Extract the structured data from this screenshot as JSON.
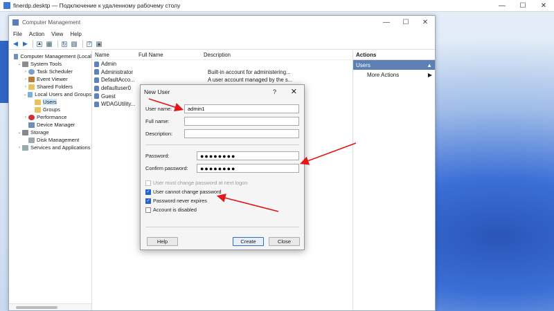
{
  "rdp": {
    "title": "finerdp.desktp — Подключение к удаленному рабочему столу",
    "controls": [
      "—",
      "☐",
      "✕"
    ]
  },
  "cm": {
    "title": "Computer Management",
    "controls": [
      "—",
      "☐",
      "✕"
    ],
    "menu": [
      "File",
      "Action",
      "View",
      "Help"
    ],
    "tree": [
      {
        "label": "Computer Management (Local",
        "icon": "computer-icon",
        "exp": "",
        "indent": 0
      },
      {
        "label": "System Tools",
        "icon": "tools-icon",
        "exp": "⌄",
        "indent": 1
      },
      {
        "label": "Task Scheduler",
        "icon": "clock-icon",
        "exp": "›",
        "indent": 2
      },
      {
        "label": "Event Viewer",
        "icon": "event-viewer-icon",
        "exp": "›",
        "indent": 2
      },
      {
        "label": "Shared Folders",
        "icon": "folder-icon",
        "exp": "›",
        "indent": 2
      },
      {
        "label": "Local Users and Groups",
        "icon": "users-icon",
        "exp": "⌄",
        "indent": 2
      },
      {
        "label": "Users",
        "icon": "folder-icon",
        "exp": "",
        "indent": 3,
        "selected": true
      },
      {
        "label": "Groups",
        "icon": "folder-icon",
        "exp": "",
        "indent": 3
      },
      {
        "label": "Performance",
        "icon": "performance-icon",
        "exp": "›",
        "indent": 2
      },
      {
        "label": "Device Manager",
        "icon": "device-manager-icon",
        "exp": "",
        "indent": 2
      },
      {
        "label": "Storage",
        "icon": "storage-icon",
        "exp": "⌄",
        "indent": 1
      },
      {
        "label": "Disk Management",
        "icon": "disk-icon",
        "exp": "",
        "indent": 2
      },
      {
        "label": "Services and Applications",
        "icon": "services-icon",
        "exp": "›",
        "indent": 1
      }
    ],
    "columns": [
      "Name",
      "Full Name",
      "Description"
    ],
    "users": [
      {
        "name": "Admin",
        "full": "",
        "desc": ""
      },
      {
        "name": "Administrator",
        "full": "",
        "desc": "Built-in account for administering..."
      },
      {
        "name": "DefaultAcco...",
        "full": "",
        "desc": "A user account managed by the s..."
      },
      {
        "name": "defaultuser0",
        "full": "",
        "desc": ""
      },
      {
        "name": "Guest",
        "full": "",
        "desc": ""
      },
      {
        "name": "WDAGUtility...",
        "full": "",
        "desc": ""
      }
    ],
    "actions": {
      "header": "Actions",
      "section": "Users",
      "more": "More Actions"
    }
  },
  "dialog": {
    "title": "New User",
    "help_glyph": "?",
    "close_glyph": "✕",
    "username_label": "User name:",
    "username_value": "admin1",
    "fullname_label": "Full name:",
    "fullname_value": "",
    "description_label": "Description:",
    "description_value": "",
    "password_label": "Password:",
    "password_value": "●●●●●●●●",
    "confirm_label": "Confirm password:",
    "confirm_value": "●●●●●●●●",
    "cb_must_change": {
      "label": "User must change password at next logon",
      "checked": false,
      "disabled": true
    },
    "cb_cannot_change": {
      "label": "User cannot change password",
      "checked": true,
      "disabled": false
    },
    "cb_never_expires": {
      "label": "Password never expires",
      "checked": true,
      "disabled": false
    },
    "cb_disabled": {
      "label": "Account is disabled",
      "checked": false,
      "disabled": false
    },
    "help_button": "Help",
    "create_button": "Create",
    "close_button": "Close"
  }
}
